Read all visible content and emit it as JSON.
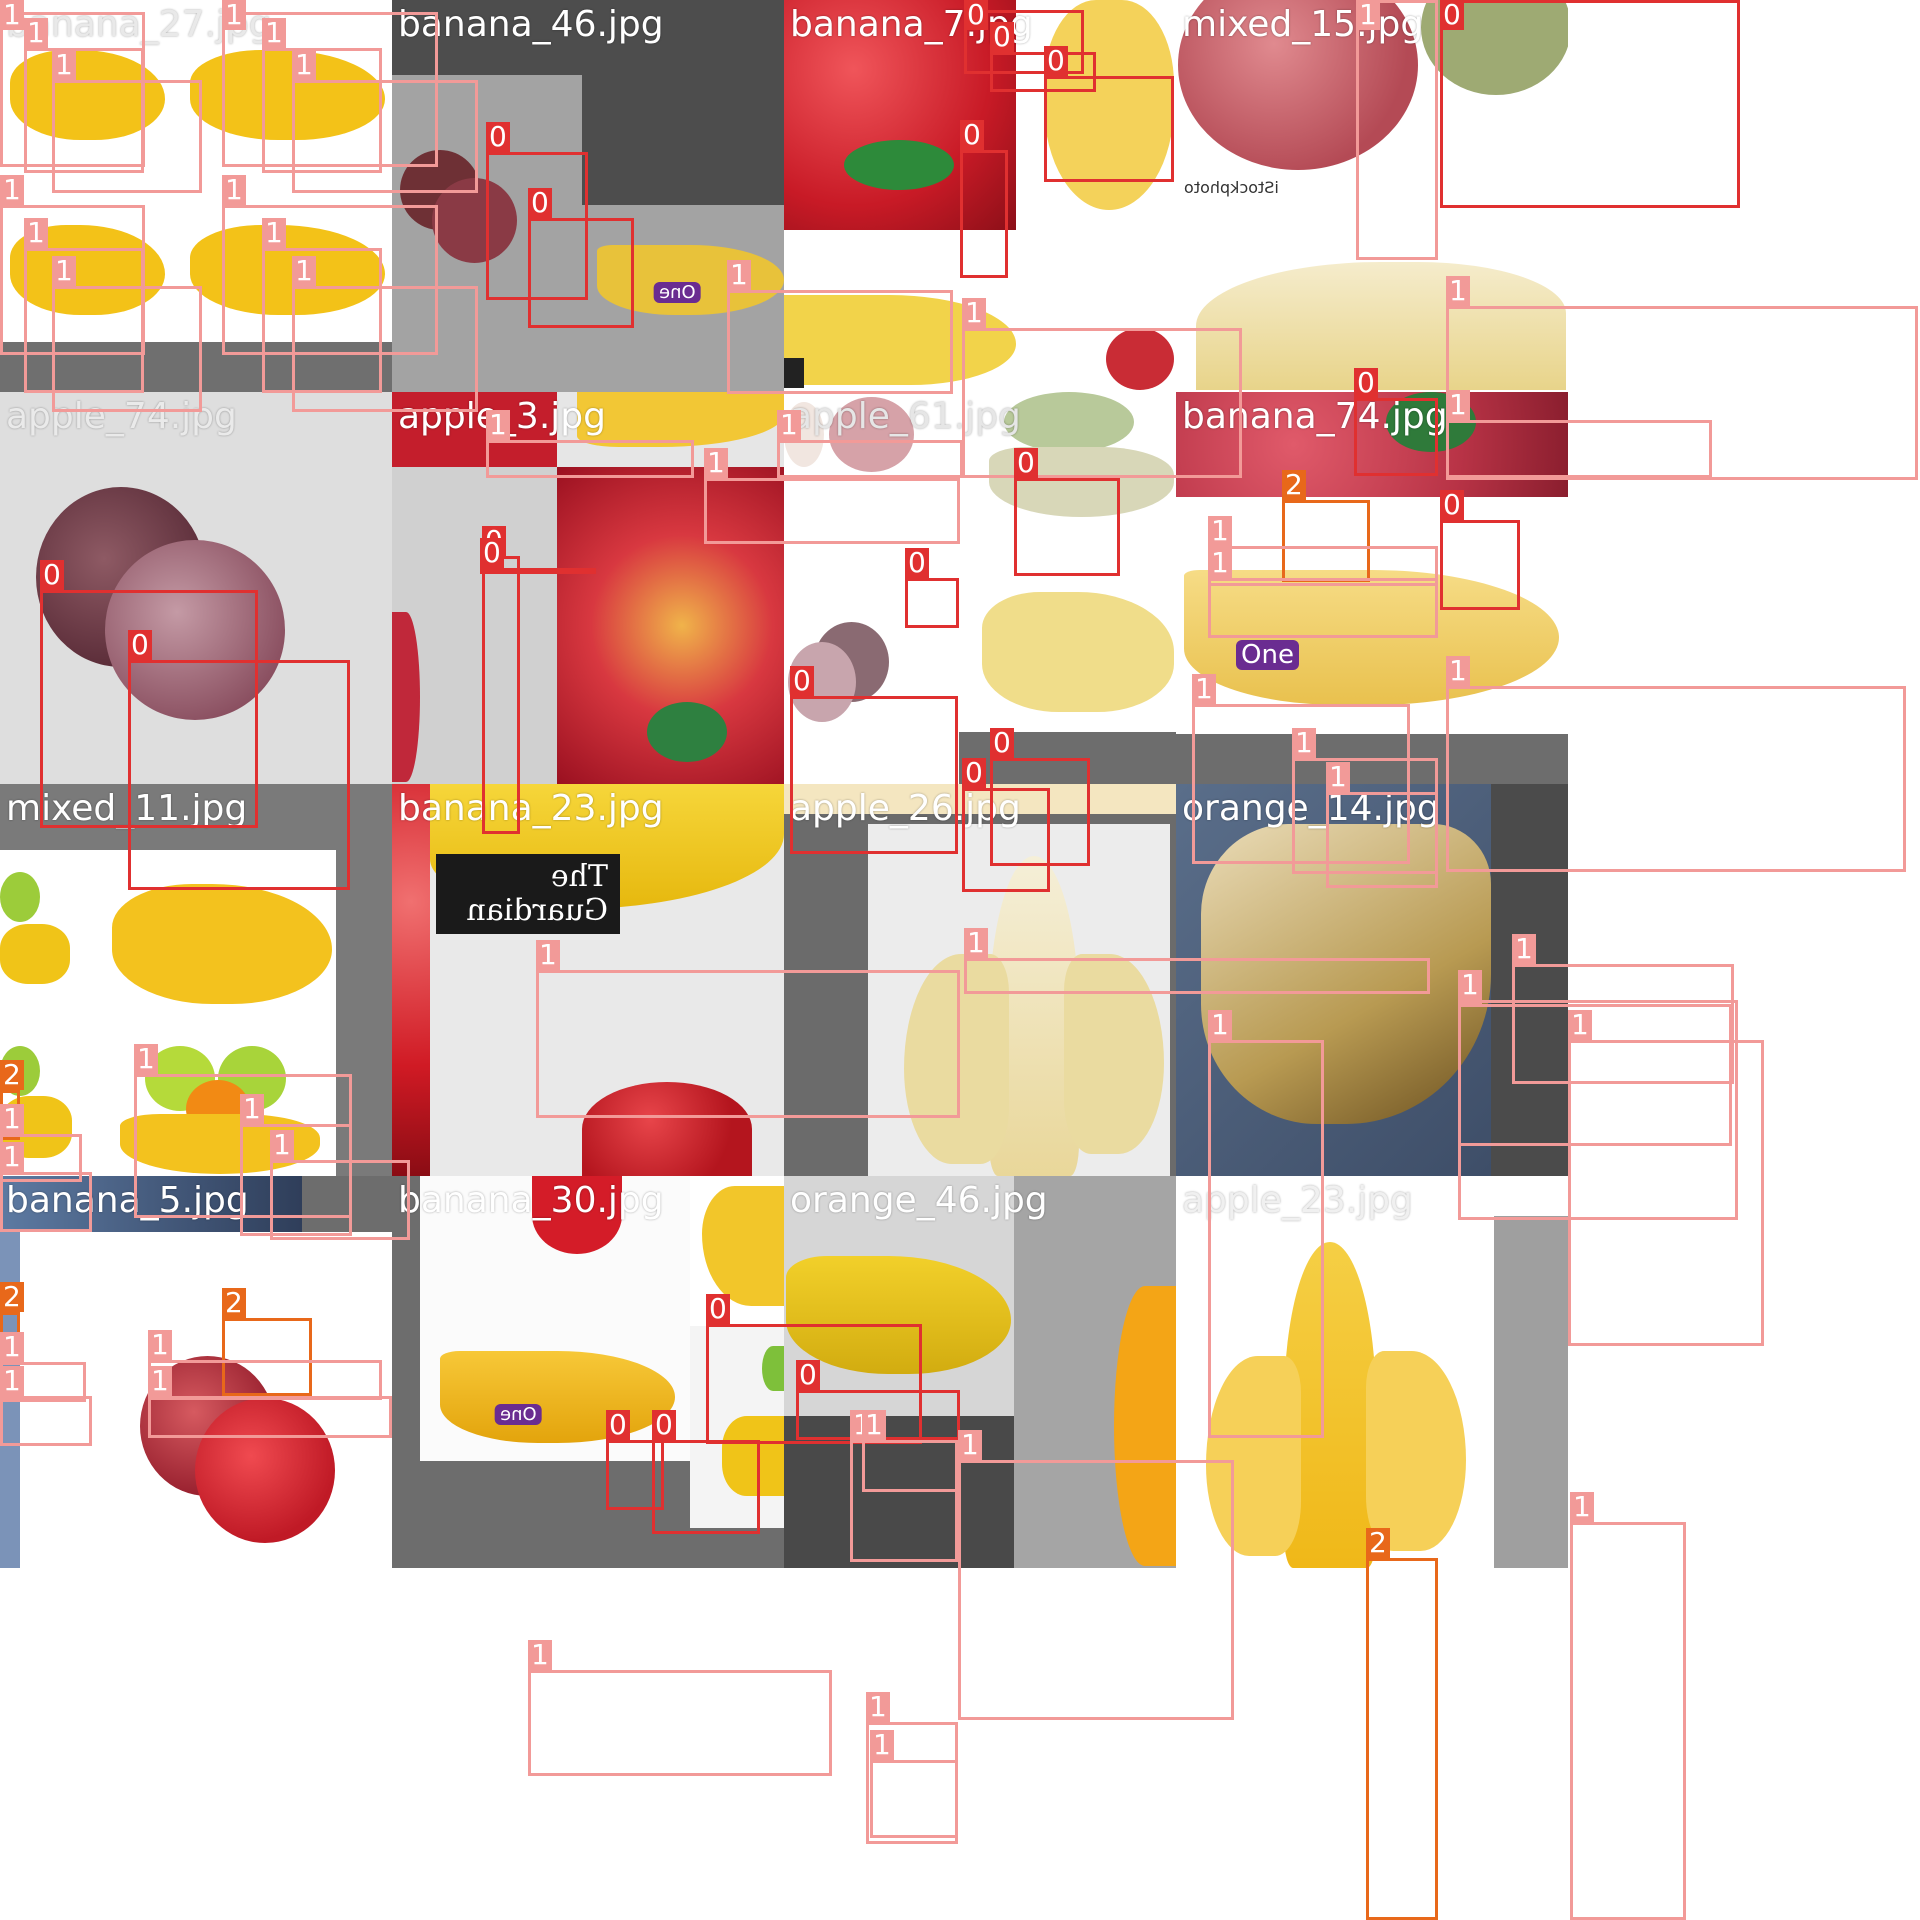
{
  "mosaic": {
    "colors": {
      "class_0": "#e03030",
      "class_1": "#f29a98",
      "class_2": "#e8681a"
    },
    "tiles": [
      {
        "label": "banana_27.jpg"
      },
      {
        "label": "banana_46.jpg"
      },
      {
        "label": "banana_7.jpg"
      },
      {
        "label": "mixed_15.jpg"
      },
      {
        "label": "apple_74.jpg"
      },
      {
        "label": "apple_3.jpg"
      },
      {
        "label": "apple_61.jpg"
      },
      {
        "label": "banana_74.jpg"
      },
      {
        "label": "mixed_11.jpg"
      },
      {
        "label": "banana_23.jpg"
      },
      {
        "label": "apple_26.jpg"
      },
      {
        "label": "orange_14.jpg"
      },
      {
        "label": "banana_5.jpg"
      },
      {
        "label": "banana_30.jpg"
      },
      {
        "label": "orange_46.jpg"
      },
      {
        "label": "apple_23.jpg"
      }
    ],
    "class_tags": {
      "c0": "0",
      "c1": "1",
      "c2": "2"
    },
    "image_text": {
      "istock": "iStockphoto",
      "one_logo": "One",
      "guardian": "The Guardian"
    }
  }
}
